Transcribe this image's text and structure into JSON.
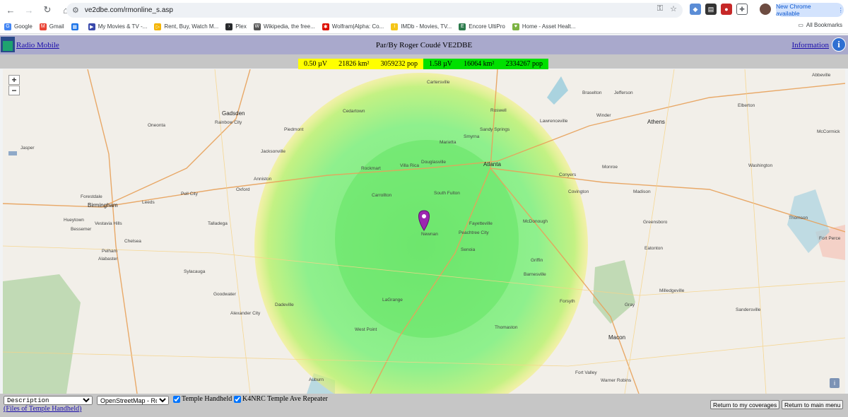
{
  "browser": {
    "url": "ve2dbe.com/rmonline_s.asp",
    "update_label": "New Chrome available",
    "bookmarks": [
      {
        "label": "Google",
        "color": "#4285f4",
        "glyph": "G"
      },
      {
        "label": "Gmail",
        "color": "#ea4335",
        "glyph": "M"
      },
      {
        "label": "",
        "color": "#1a73e8",
        "glyph": "▦"
      },
      {
        "label": "My Movies & TV -...",
        "color": "#3949ab",
        "glyph": "▶"
      },
      {
        "label": "Rent, Buy, Watch M...",
        "color": "#f4b400",
        "glyph": "▷"
      },
      {
        "label": "Plex",
        "color": "#282a2d",
        "glyph": "›"
      },
      {
        "label": "Wikipedia, the free...",
        "color": "#555555",
        "glyph": "W"
      },
      {
        "label": "Wolfram|Alpha: Co...",
        "color": "#dd1100",
        "glyph": "✱"
      },
      {
        "label": "IMDb - Movies, TV...",
        "color": "#f5c518",
        "glyph": "i"
      },
      {
        "label": "Encore UltiPro",
        "color": "#2b7a4b",
        "glyph": "E"
      },
      {
        "label": "Home - Asset Healt...",
        "color": "#7cb342",
        "glyph": "♥"
      }
    ],
    "all_bookmarks": "All Bookmarks"
  },
  "header": {
    "app_link": "Radio Mobile",
    "title": "Par/By Roger Coudé VE2DBE",
    "info_link": "Information",
    "info_glyph": "i"
  },
  "legend": [
    {
      "signal": "0.50 µV",
      "area": "21826 km²",
      "pop": "3059232 pop",
      "color": "#ffff00"
    },
    {
      "signal": "1.58 µV",
      "area": "16064 km²",
      "pop": "2334267 pop",
      "color": "#00e000"
    }
  ],
  "map": {
    "zoom_in": "+",
    "zoom_out": "−",
    "places": [
      {
        "name": "Gadsden"
      },
      {
        "name": "Rainbow City"
      },
      {
        "name": "Oneonta"
      },
      {
        "name": "Piedmont"
      },
      {
        "name": "Jacksonville"
      },
      {
        "name": "Anniston"
      },
      {
        "name": "Oxford"
      },
      {
        "name": "Pell City"
      },
      {
        "name": "Birmingham"
      },
      {
        "name": "Forestdale"
      },
      {
        "name": "Leeds"
      },
      {
        "name": "Hueytown"
      },
      {
        "name": "Bessemer"
      },
      {
        "name": "Vestavia Hills"
      },
      {
        "name": "Pelham"
      },
      {
        "name": "Alabaster"
      },
      {
        "name": "Chelsea"
      },
      {
        "name": "Talladega"
      },
      {
        "name": "Sylacauga"
      },
      {
        "name": "Goodwater"
      },
      {
        "name": "Alexander City"
      },
      {
        "name": "Dadeville"
      },
      {
        "name": "Auburn"
      },
      {
        "name": "Carrollton"
      },
      {
        "name": "Villa Rica"
      },
      {
        "name": "Douglasville"
      },
      {
        "name": "Newnan"
      },
      {
        "name": "Peachtree City"
      },
      {
        "name": "Fayetteville"
      },
      {
        "name": "Senoia"
      },
      {
        "name": "LaGrange"
      },
      {
        "name": "West Point"
      },
      {
        "name": "Thomaston"
      },
      {
        "name": "Barnesville"
      },
      {
        "name": "Forsyth"
      },
      {
        "name": "Griffin"
      },
      {
        "name": "McDonough"
      },
      {
        "name": "Atlanta"
      },
      {
        "name": "Smyrna"
      },
      {
        "name": "Marietta"
      },
      {
        "name": "Sandy Springs"
      },
      {
        "name": "Roswell"
      },
      {
        "name": "Lawrenceville"
      },
      {
        "name": "Athens"
      },
      {
        "name": "Conyers"
      },
      {
        "name": "Covington"
      },
      {
        "name": "Monroe"
      },
      {
        "name": "Madison"
      },
      {
        "name": "Greensboro"
      },
      {
        "name": "Eatonton"
      },
      {
        "name": "Milledgeville"
      },
      {
        "name": "Sandersville"
      },
      {
        "name": "Gray"
      },
      {
        "name": "Macon"
      },
      {
        "name": "Warner Robins"
      },
      {
        "name": "Fort Valley"
      },
      {
        "name": "Washington"
      },
      {
        "name": "Thomson"
      },
      {
        "name": "McCormick"
      },
      {
        "name": "Abbeville"
      },
      {
        "name": "Cartersville"
      },
      {
        "name": "Cedartown"
      },
      {
        "name": "Rockmart"
      },
      {
        "name": "South Fulton"
      },
      {
        "name": "Jasper"
      },
      {
        "name": "Braselton"
      },
      {
        "name": "Jefferson"
      },
      {
        "name": "Winder"
      },
      {
        "name": "Elberton"
      },
      {
        "name": "Fort Perce"
      }
    ]
  },
  "controls": {
    "display_select": "Description",
    "map_select": "OpenStreetMap - Road",
    "check1": "Temple Handheld",
    "check2": "K4NRC Temple Ave Repeater",
    "files_link": "(Files of Temple Handheld)",
    "btn_coverages": "Return to my coverages",
    "btn_main": "Return to main menu"
  }
}
